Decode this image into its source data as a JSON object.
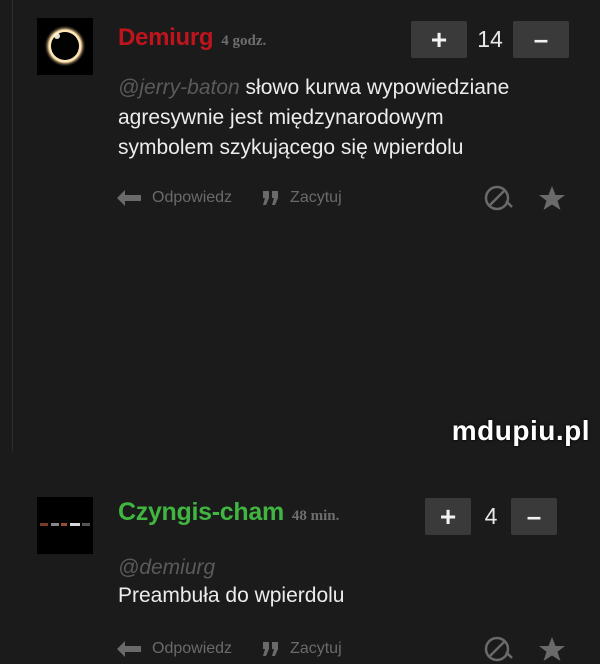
{
  "comments": [
    {
      "author": "Demiurg",
      "time": "4 godz.",
      "author_color": "#c0141c",
      "avatar_icon": "solar-eclipse",
      "vote_count": "14",
      "vote_plus": "+",
      "vote_minus": "–",
      "reply_to": "@jerry-baton",
      "body_lines": [
        "słowo kurwa wypowiedziane",
        "agresywnie jest międzynarodowym",
        "symbolem szykującego się wpierdolu"
      ],
      "actions": {
        "reply": "Odpowiedz",
        "quote": "Zacytuj"
      }
    },
    {
      "author": "Czyngis-cham",
      "time": "48 min.",
      "author_color": "#40b640",
      "avatar_icon": "pixel-figure",
      "vote_count": "4",
      "vote_plus": "+",
      "vote_minus": "–",
      "reply_to": "@demiurg",
      "body_lines": [
        "Preambuła do wpierdolu"
      ],
      "actions": {
        "reply": "Odpowiedz",
        "quote": "Zacytuj"
      }
    }
  ],
  "watermark": "mdupiu.pl"
}
